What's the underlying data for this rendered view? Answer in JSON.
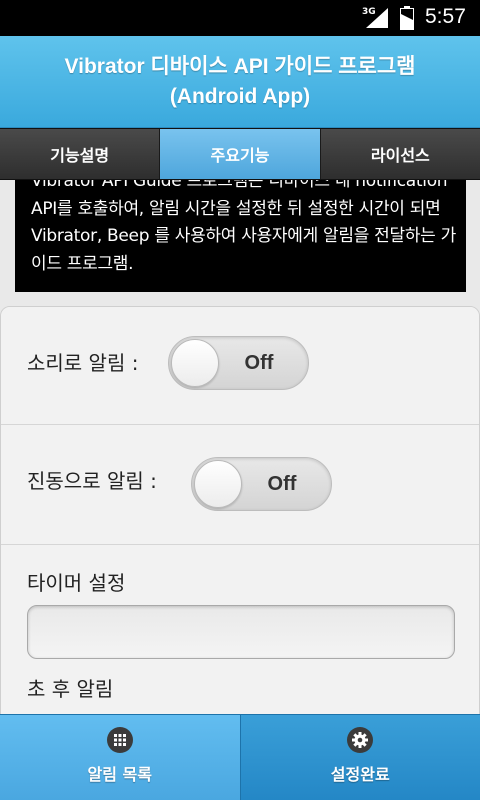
{
  "status_bar": {
    "network": "3G",
    "time": "5:57"
  },
  "header": {
    "title_line1": "Vibrator 디바이스 API 가이드 프로그램",
    "title_line2": "(Android App)"
  },
  "tabs": [
    {
      "label": "기능설명",
      "active": false
    },
    {
      "label": "주요기능",
      "active": true
    },
    {
      "label": "라이선스",
      "active": false
    }
  ],
  "description": "Vibrator API Guide 프로그램은 디바이스 내 notification API를 호출하여, 알림 시간을 설정한 뒤 설정한 시간이 되면 Vibrator, Beep 를 사용하여 사용자에게 알림을 전달하는 가이드 프로그램.",
  "settings": {
    "sound_label": "소리로 알림 :",
    "sound_state": "Off",
    "vibrate_label": "진동으로 알림 :",
    "vibrate_state": "Off",
    "timer_label": "타이머 설정",
    "timer_value": "",
    "timer_suffix": "초 후 알림"
  },
  "bottom_nav": {
    "list_label": "알림 목록",
    "list_icon": "grid-icon",
    "done_label": "설정완료",
    "done_icon": "gear-icon"
  }
}
